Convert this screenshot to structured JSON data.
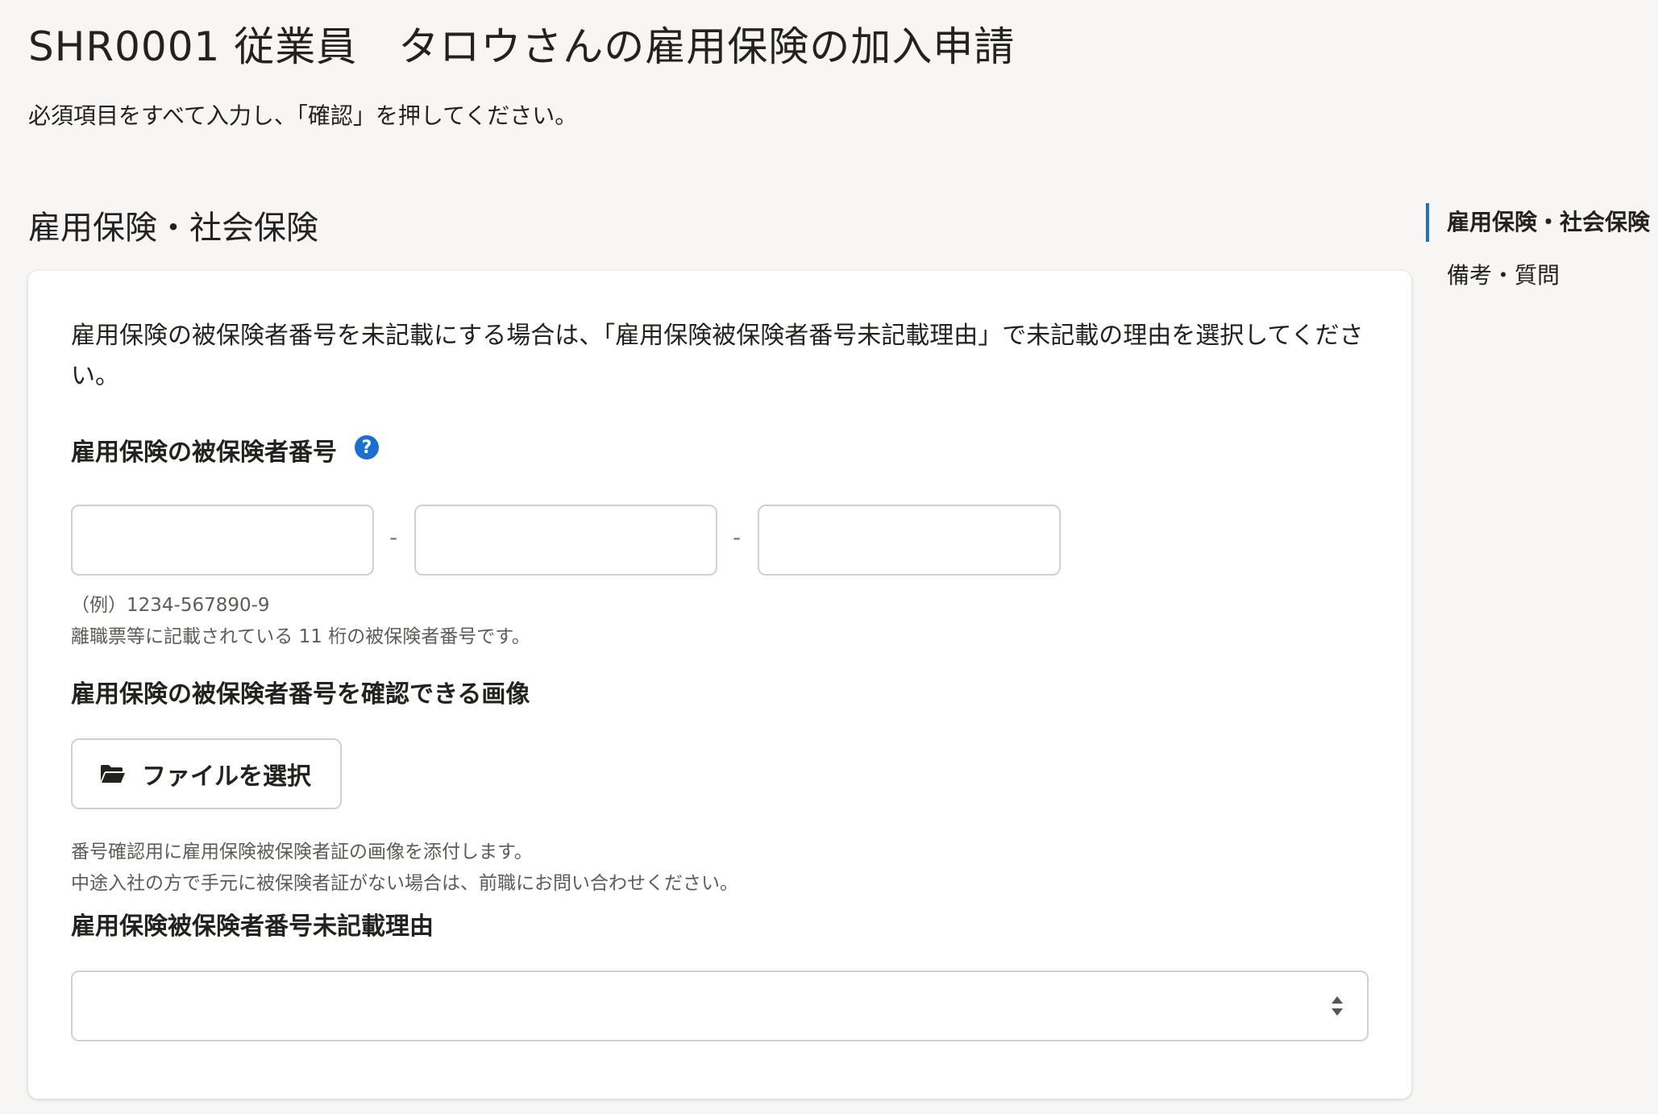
{
  "header": {
    "title": "SHR0001 従業員　タロウさんの雇用保険の加入申請",
    "lead": "必須項目をすべて入力し、「確認」を押してください。"
  },
  "section": {
    "title": "雇用保険・社会保険",
    "note": "雇用保険の被保険者番号を未記載にする場合は、「雇用保険被保険者番号未記載理由」で未記載の理由を選択してください。"
  },
  "insured_number": {
    "label": "雇用保険の被保険者番号",
    "help_icon": "question-circle-icon",
    "separator": "-",
    "part1_value": "",
    "part2_value": "",
    "part3_value": "",
    "example": "（例）1234-567890-9",
    "description": "離職票等に記載されている 11 桁の被保険者番号です。"
  },
  "image_upload": {
    "label": "雇用保険の被保険者番号を確認できる画像",
    "button_label": "ファイルを選択",
    "icon": "folder-open-icon",
    "hint_line1": "番号確認用に雇用保険被保険者証の画像を添付します。",
    "hint_line2": "中途入社の方で手元に被保険者証がない場合は、前職にお問い合わせください。"
  },
  "missing_reason": {
    "label": "雇用保険被保険者番号未記載理由",
    "selected_value": ""
  },
  "toc": {
    "items": [
      {
        "label": "雇用保険・社会保険",
        "active": true
      },
      {
        "label": "備考・質問",
        "active": false
      }
    ]
  },
  "colors": {
    "accent": "#1a6fcf",
    "background": "#f7f6f4",
    "card": "#ffffff",
    "border": "#d2d0cc"
  }
}
